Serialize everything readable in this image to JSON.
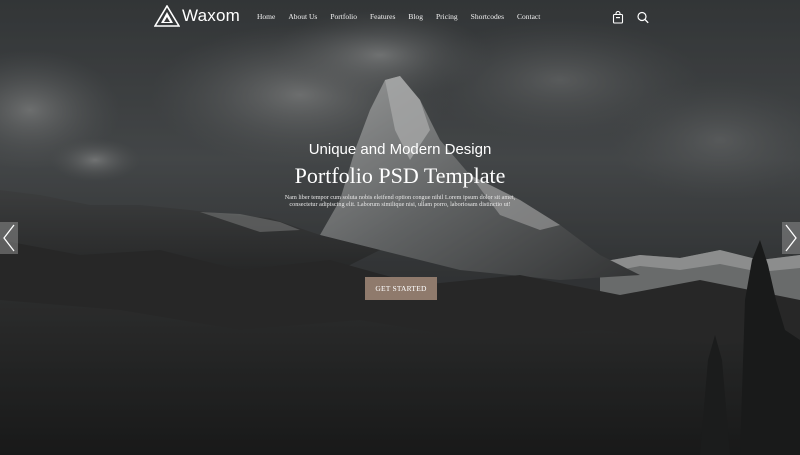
{
  "brand": {
    "name": "Waxom"
  },
  "nav": {
    "items": [
      {
        "label": "Home"
      },
      {
        "label": "About Us"
      },
      {
        "label": "Portfolio"
      },
      {
        "label": "Features"
      },
      {
        "label": "Blog"
      },
      {
        "label": "Pricing"
      },
      {
        "label": "Shortcodes"
      },
      {
        "label": "Contact"
      }
    ]
  },
  "header_icons": {
    "cart": "shopping-bag-icon",
    "search": "search-icon"
  },
  "hero": {
    "subtitle": "Unique and Modern Design",
    "title": "Portfolio PSD Template",
    "description": "Nam liber tempor cum soluta nobis eleifend option congue nihil Lorem ipsum dolor sit amet, consectetur adipiscing elit. Laborum similique nisi, ullam porro, laboriosam distinctio ut!",
    "cta_label": "GET STARTED"
  },
  "slider": {
    "prev_icon": "chevron-left-icon",
    "next_icon": "chevron-right-icon"
  },
  "colors": {
    "accent": "#8f7a6c",
    "overlay": "#2a2b2d"
  }
}
